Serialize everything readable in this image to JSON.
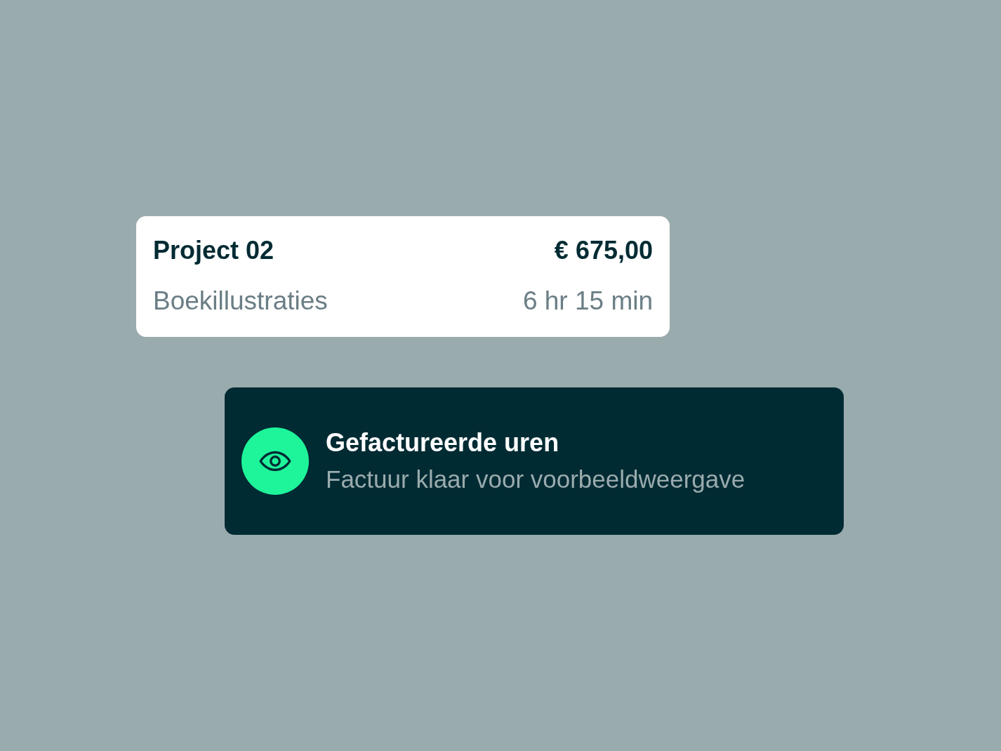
{
  "project_card": {
    "title": "Project 02",
    "amount": "€ 675,00",
    "subtitle": "Boekillustraties",
    "duration": "6 hr 15 min"
  },
  "notification": {
    "title": "Gefactureerde uren",
    "message": "Factuur klaar voor voorbeeldweergave"
  }
}
